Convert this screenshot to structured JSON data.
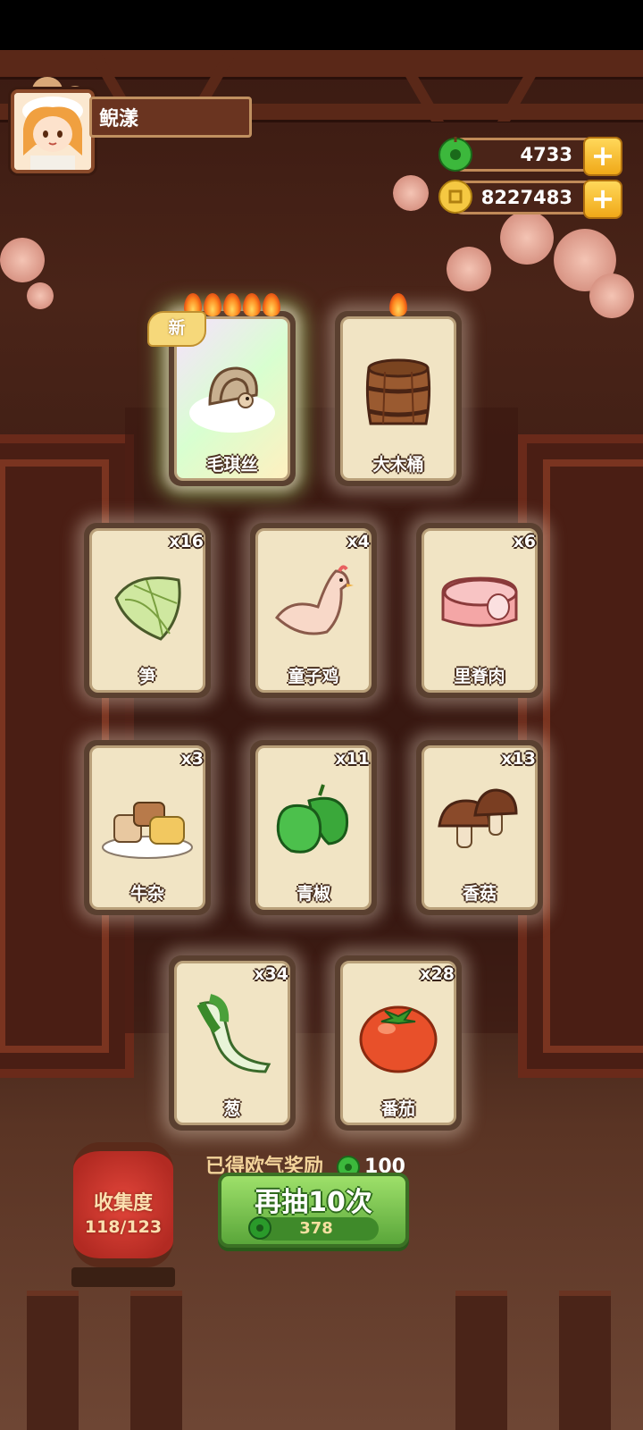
{
  "player": {
    "name": "鲵漾"
  },
  "currencies": [
    {
      "icon": "green-jade-icon",
      "value": "4733"
    },
    {
      "icon": "gold-coin-icon",
      "value": "8227483"
    }
  ],
  "cards": [
    {
      "label": "毛琪丝",
      "count": "",
      "flames": 5,
      "new_badge": "新",
      "art": "hermit-crab-creature-art",
      "special": true
    },
    {
      "label": "大木桶",
      "count": "",
      "flames": 1,
      "art": "wooden-barrel-art"
    },
    {
      "label": "笋",
      "count": "x16",
      "art": "bamboo-shoot-art"
    },
    {
      "label": "童子鸡",
      "count": "x4",
      "art": "chicken-art"
    },
    {
      "label": "里脊肉",
      "count": "x6",
      "art": "tenderloin-meat-art"
    },
    {
      "label": "牛杂",
      "count": "x3",
      "art": "beef-offal-art"
    },
    {
      "label": "青椒",
      "count": "x11",
      "art": "green-pepper-art"
    },
    {
      "label": "香菇",
      "count": "x13",
      "art": "mushroom-art"
    },
    {
      "label": "葱",
      "count": "x34",
      "art": "scallion-art"
    },
    {
      "label": "番茄",
      "count": "x28",
      "art": "tomato-art"
    }
  ],
  "reward": {
    "text": "已得欧气奖励",
    "amount": "100"
  },
  "collection": {
    "title": "收集度",
    "progress": "118/123"
  },
  "draw_button": {
    "label": "再抽10次",
    "cost": "378"
  }
}
